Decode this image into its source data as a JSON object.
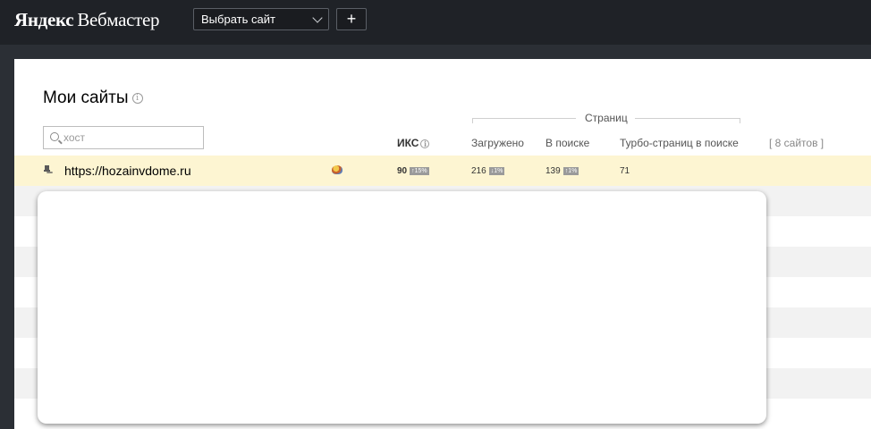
{
  "header": {
    "logo_brand": "Яндекс",
    "logo_product": "Вебмастер",
    "site_select_label": "Выбрать сайт",
    "add_label": "+"
  },
  "main": {
    "title": "Мои сайты",
    "info_glyph": "i",
    "search_placeholder": "хост",
    "group_label": "Страниц",
    "columns": {
      "iks": "ИКС",
      "loaded": "Загружено",
      "in_search": "В поиске",
      "turbo": "Турбо-страниц в поиске",
      "count": "[ 8 сайтов ]"
    },
    "rows": [
      {
        "url": "https://hozainvdome.ru",
        "iks": "90",
        "iks_delta": "↑15%",
        "loaded": "216",
        "loaded_delta": "↓1%",
        "in_search": "139",
        "in_search_delta": "↑1%",
        "turbo": "71"
      }
    ]
  },
  "icons": {
    "pin": "pin-icon",
    "search": "search-icon",
    "info": "info-icon",
    "chevron": "chevron-down-icon",
    "favicon": "site-favicon"
  }
}
